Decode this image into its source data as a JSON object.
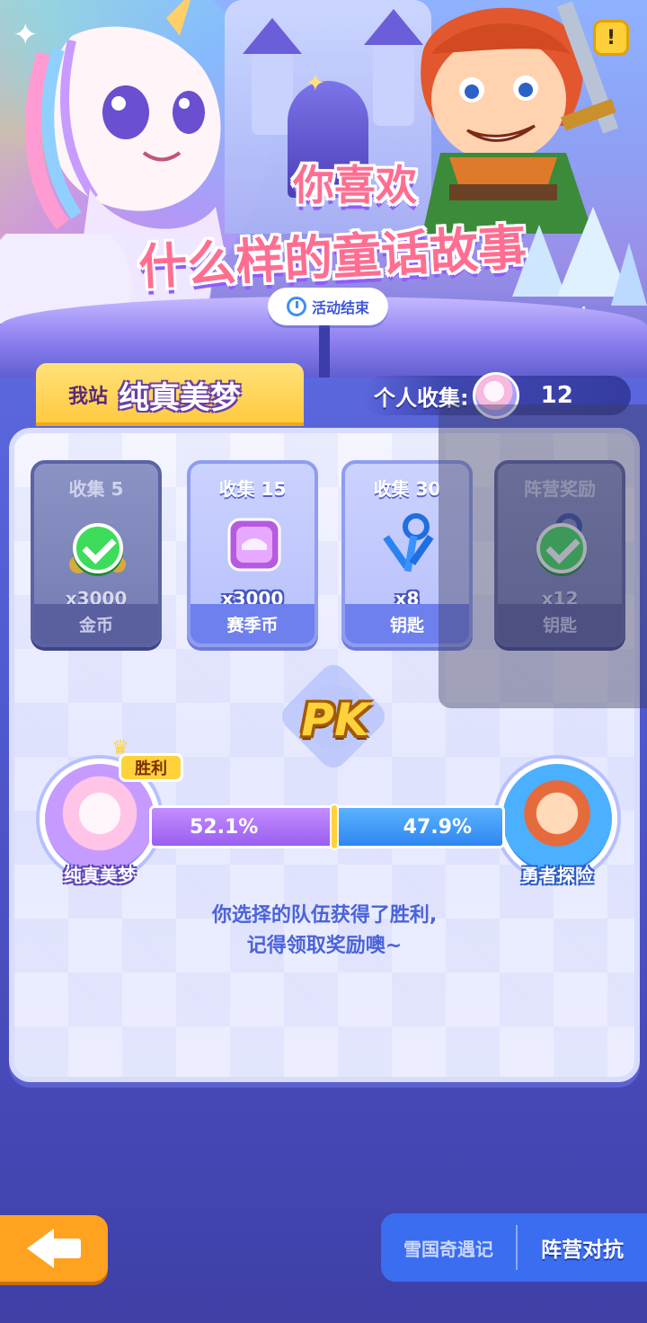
{
  "banner": {
    "title_line1": "你喜欢",
    "title_line2": "什么样的童话故事",
    "status_pill": "活动结束",
    "alert_icon": "!"
  },
  "team": {
    "prefix": "我站",
    "name": "纯真美梦"
  },
  "collection": {
    "label": "个人收集:",
    "count": "12"
  },
  "rewards": [
    {
      "title": "收集 5",
      "quantity": "x3000",
      "item": "金币",
      "icon": "coin-bag-icon",
      "claimed": true
    },
    {
      "title": "收集 15",
      "quantity": "x3000",
      "item": "赛季币",
      "icon": "season-coin-icon",
      "claimed": false
    },
    {
      "title": "收集 30",
      "quantity": "x8",
      "item": "钥匙",
      "icon": "keys-icon",
      "claimed": false
    },
    {
      "title": "阵营奖励",
      "quantity": "x12",
      "item": "钥匙",
      "icon": "keys-icon",
      "claimed": true
    }
  ],
  "pk": {
    "label": "PK",
    "win_tag": "胜利",
    "left_team": "纯真美梦",
    "right_team": "勇者探险",
    "left_percent": "52.1%",
    "right_percent": "47.9%",
    "left_share": 0.521,
    "result_line1": "你选择的队伍获得了胜利,",
    "result_line2": "记得领取奖励噢~"
  },
  "bottom": {
    "back_icon": "back-arrow-icon",
    "tab_inactive": "雪国奇遇记",
    "tab_active": "阵营对抗"
  },
  "colors": {
    "accent_orange": "#ffa21f",
    "team_tab_yellow": "#ffc93c",
    "left_team_purple": "#9a5ef0",
    "right_team_blue": "#2f86f2",
    "claimed_green": "#3ddc5a"
  }
}
